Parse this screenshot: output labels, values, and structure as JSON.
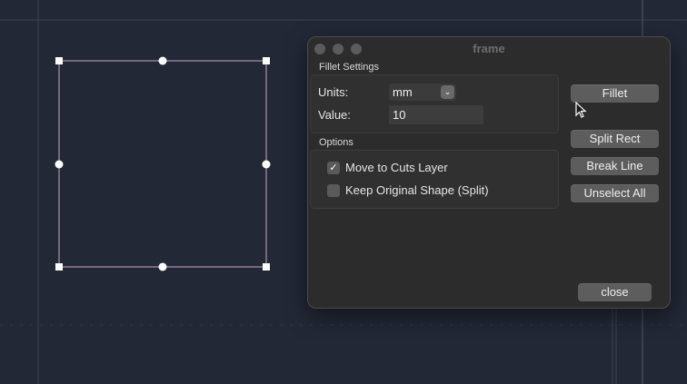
{
  "dialog": {
    "title": "frame",
    "fillet_settings": {
      "label": "Fillet Settings",
      "units_label": "Units:",
      "units_value": "mm",
      "value_label": "Value:",
      "value": "10"
    },
    "options": {
      "label": "Options",
      "move_to_cuts": {
        "label": "Move to Cuts Layer",
        "checked": true
      },
      "keep_original": {
        "label": "Keep Original Shape (Split)",
        "checked": false
      }
    },
    "buttons": {
      "fillet": "Fillet",
      "split_rect": "Split Rect",
      "break_line": "Break Line",
      "unselect_all": "Unselect All",
      "close": "close"
    }
  },
  "colors": {
    "canvas_bg": "#232836",
    "selection_outline": "#c9a7c0",
    "handle_fill": "#ffffff",
    "dialog_bg": "#2c2c2c",
    "button_bg": "#5d5d5d"
  },
  "icons": {
    "check": "checkmark-icon",
    "dropdown": "chevron-down-icon",
    "cursor": "mouse-pointer-icon"
  }
}
